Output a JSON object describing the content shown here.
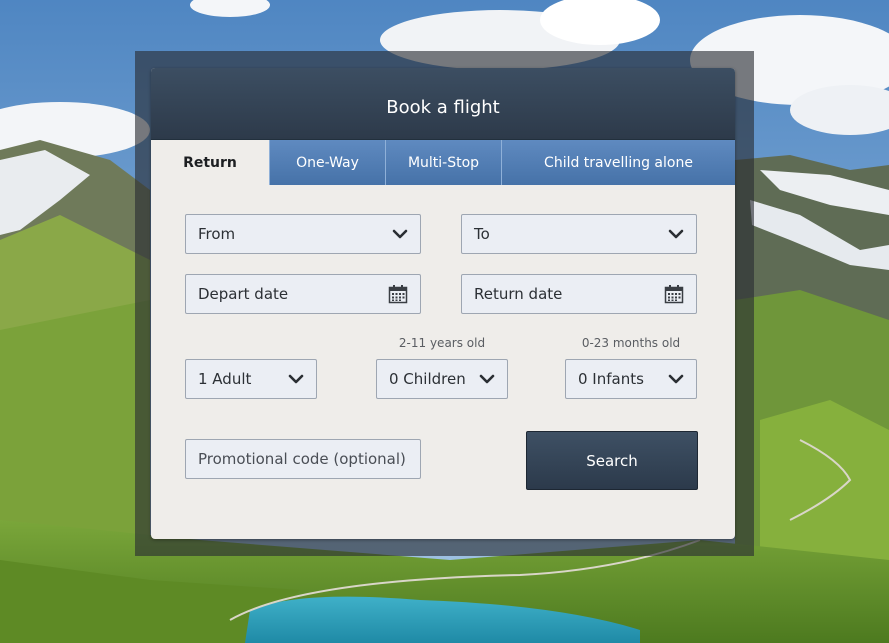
{
  "colors": {
    "header_bg": "#34465a",
    "tab_bg": "#5580b6",
    "panel_bg": "#efedea",
    "field_bg": "#ebeef4",
    "search_bg": "#34465a"
  },
  "panel": {
    "title": "Book a flight"
  },
  "tabs": [
    {
      "label": "Return",
      "active": true
    },
    {
      "label": "One-Way",
      "active": false
    },
    {
      "label": "Multi-Stop",
      "active": false
    },
    {
      "label": "Child travelling alone",
      "active": false
    }
  ],
  "form": {
    "from": {
      "value": "From",
      "icon": "chevron-down-icon"
    },
    "to": {
      "value": "To",
      "icon": "chevron-down-icon"
    },
    "depart_date": {
      "placeholder": "Depart date",
      "icon": "calendar-icon"
    },
    "return_date": {
      "placeholder": "Return date",
      "icon": "calendar-icon"
    },
    "adults": {
      "value": "1 Adult"
    },
    "children": {
      "hint": "2-11 years old",
      "value": "0 Children"
    },
    "infants": {
      "hint": "0-23 months old",
      "value": "0 Infants"
    },
    "promo": {
      "placeholder": "Promotional code (optional)"
    },
    "search_label": "Search"
  }
}
